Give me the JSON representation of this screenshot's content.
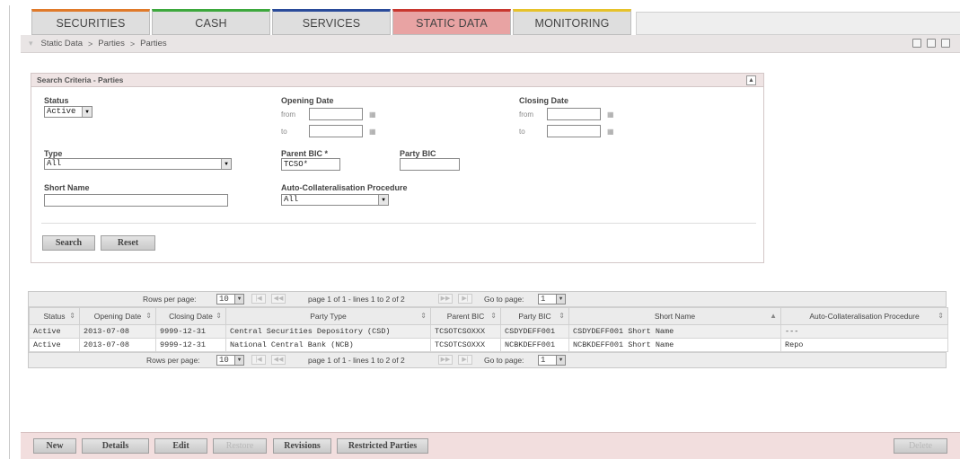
{
  "tabs": [
    {
      "label": "SECURITIES",
      "color": "#e07a2a"
    },
    {
      "label": "CASH",
      "color": "#3da83d"
    },
    {
      "label": "SERVICES",
      "color": "#2a4b9a"
    },
    {
      "label": "STATIC DATA",
      "color": "#c8372f",
      "active": true
    },
    {
      "label": "MONITORING",
      "color": "#e6c22a"
    }
  ],
  "breadcrumb": [
    "Static Data",
    "Parties",
    "Parties"
  ],
  "breadcrumb_sep": ">",
  "search": {
    "title": "Search Criteria - Parties",
    "status_label": "Status",
    "status_value": "Active",
    "opening_label": "Opening Date",
    "closing_label": "Closing Date",
    "from_label": "from",
    "to_label": "to",
    "type_label": "Type",
    "type_value": "All",
    "parent_bic_label": "Parent BIC *",
    "parent_bic_value": "TCSO*",
    "party_bic_label": "Party BIC",
    "party_bic_value": "",
    "short_name_label": "Short Name",
    "short_name_value": "",
    "acp_label": "Auto-Collateralisation Procedure",
    "acp_value": "All",
    "search_button": "Search",
    "reset_button": "Reset"
  },
  "pager": {
    "rows_label": "Rows per page:",
    "rows_value": "10",
    "page_info": "page 1 of 1 - lines 1 to 2 of 2",
    "goto_label": "Go to page:",
    "goto_value": "1",
    "rows_label_bottom": "Rows per page:"
  },
  "table": {
    "columns": [
      "Status",
      "Opening Date",
      "Closing Date",
      "Party Type",
      "Parent BIC",
      "Party BIC",
      "Short Name",
      "Auto-Collateralisation Procedure"
    ],
    "rows": [
      [
        "Active",
        "2013-07-08",
        "9999-12-31",
        "Central Securities Depository (CSD)",
        "TCSOTCSOXXX",
        "CSDYDEFF001",
        "CSDYDEFF001 Short Name",
        "---"
      ],
      [
        "Active",
        "2013-07-08",
        "9999-12-31",
        "National Central Bank (NCB)",
        "TCSOTCSOXXX",
        "NCBKDEFF001",
        "NCBKDEFF001 Short Name",
        "Repo"
      ]
    ]
  },
  "actions": {
    "new": "New",
    "details": "Details",
    "edit": "Edit",
    "restore": "Restore",
    "revisions": "Revisions",
    "restricted": "Restricted Parties",
    "delete": "Delete"
  }
}
